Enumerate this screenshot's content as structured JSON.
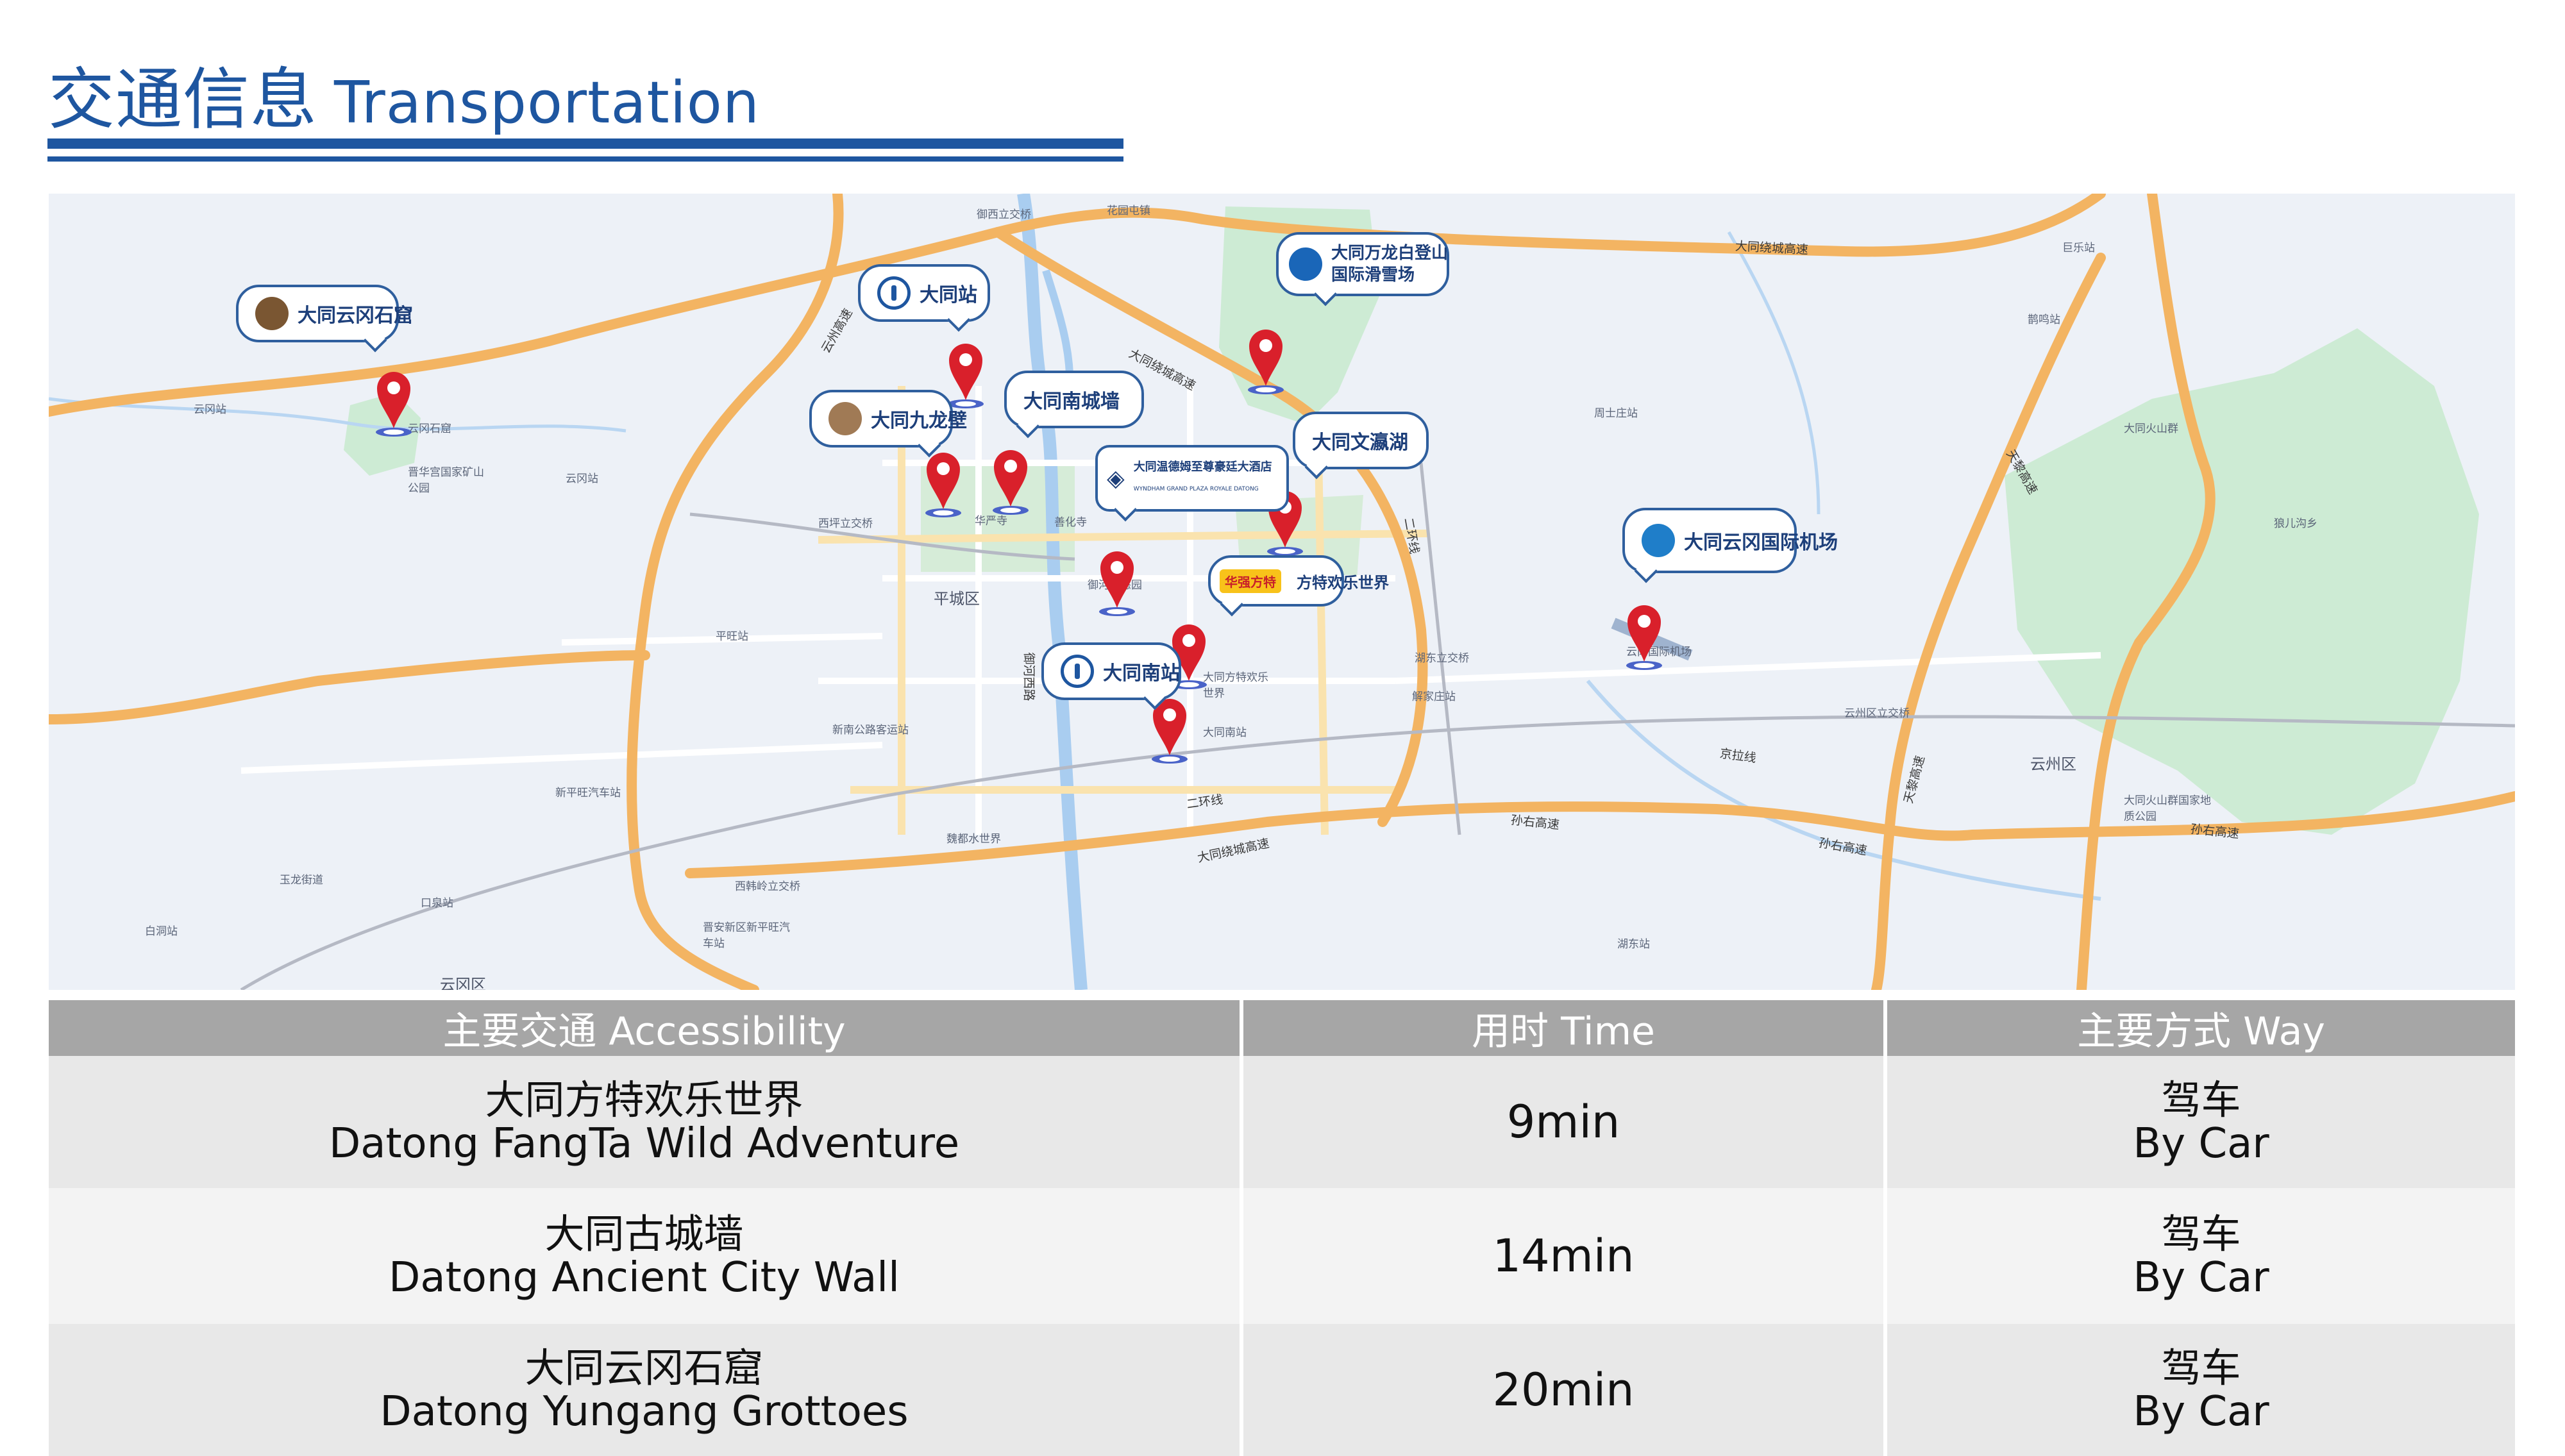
{
  "header": {
    "title_cn": "交通信息",
    "title_en": "Transportation"
  },
  "map": {
    "callouts": {
      "yungang": "大同云冈石窟",
      "datong_station": "大同站",
      "wanlong_line1": "大同万龙白登山",
      "wanlong_line2": "国际滑雪场",
      "jiulongbi": "大同九龙壁",
      "south_wall": "大同南城墙",
      "wenying": "大同文瀛湖",
      "hotel_line1": "大同温德姆至尊豪廷大酒店",
      "hotel_line2": "WYNDHAM GRAND PLAZA ROYALE DATONG",
      "fangte": "方特欢乐世界",
      "fangte_logo": "华强方特",
      "south_station": "大同南站",
      "airport": "大同云冈国际机场"
    },
    "places": {
      "p1": "御西立交桥",
      "p2": "花园屯镇",
      "p3": "云冈石窟",
      "p4": "云冈站",
      "p5": "晋华宫国家矿山公园",
      "p6": "云冈站",
      "p7": "大同站",
      "p8": "善化寺",
      "p9": "华严寺",
      "p10": "云冈国际机场",
      "p11": "平旺站",
      "p12": "御河生态园",
      "p13": "大同南站",
      "p14": "魏都水世界",
      "p15": "新平旺汽车站",
      "p16": "口泉站",
      "p17": "白洞站",
      "p18": "湖东站",
      "p19": "解家庄站",
      "p20": "周士庄站",
      "p21": "大同火山群",
      "p22": "巨乐站",
      "p23": "大同火山群国家地质公园",
      "p24": "晋安新区新平旺汽车站",
      "p25": "新南公路客运站",
      "p26": "大同方特欢乐世界",
      "p27": "西韩岭立交桥",
      "p28": "玉龙街道",
      "p29": "湖东立交桥",
      "p30": "西坪立交桥",
      "p31": "云州区立交桥",
      "p32": "鹊鸣站",
      "p33": "狼儿沟乡"
    },
    "districts": {
      "pingcheng": "平城区",
      "yunzhou": "云州区",
      "yungang": "云冈区"
    },
    "roads": {
      "ring": "大同绕城高速",
      "ring2": "大同绕城高速",
      "ring3": "大同绕城高速",
      "erhuan": "二环线",
      "erhuan2": "二环线",
      "jingla": "京拉线",
      "sunyou": "孙右高速",
      "sunyou2": "孙右高速",
      "sunyou3": "孙右高速",
      "yuhe_west": "御河西路",
      "tianli": "天黎高速",
      "tianli2": "天黎高速",
      "yunzhou_gs": "云州高速"
    }
  },
  "table": {
    "headers": [
      "主要交通 Accessibility",
      "用时 Time",
      "主要方式 Way"
    ],
    "rows": [
      {
        "cn": "大同方特欢乐世界",
        "en": "Datong FangTa Wild Adventure",
        "time": "9min",
        "way_cn": "驾车",
        "way_en": "By Car"
      },
      {
        "cn": "大同古城墙",
        "en": "Datong Ancient City Wall",
        "time": "14min",
        "way_cn": "驾车",
        "way_en": "By Car"
      },
      {
        "cn": "大同云冈石窟",
        "en": "Datong Yungang Grottoes",
        "time": "20min",
        "way_cn": "驾车",
        "way_en": "By Car"
      }
    ]
  },
  "colors": {
    "brand_blue": "#1e56a0",
    "pin_red": "#d9202b",
    "header_grey": "#a6a6a6",
    "park_green": "#cdebd4",
    "road_orange": "#f3b462"
  }
}
